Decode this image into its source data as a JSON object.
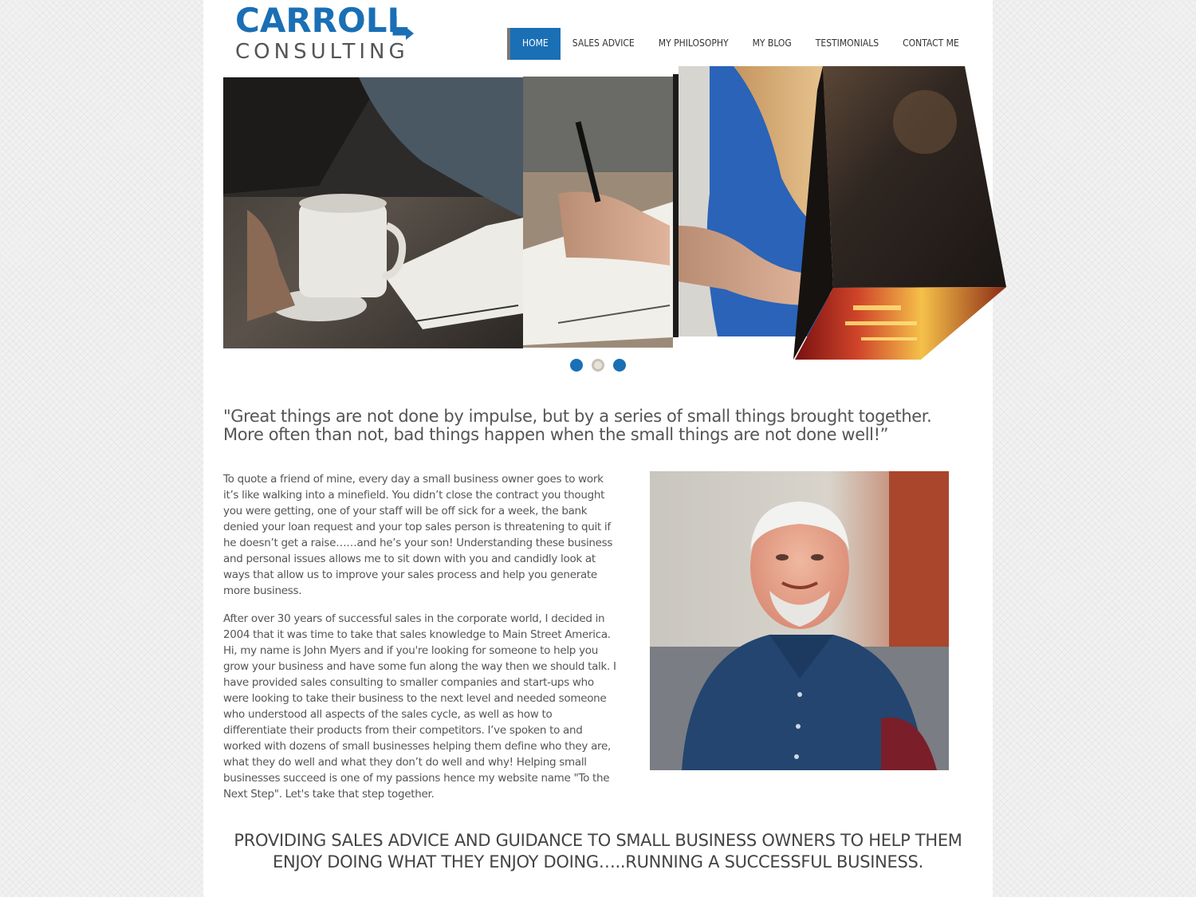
{
  "logo": {
    "line1": "CARROLL",
    "line2": "CONSULTING",
    "brand_color": "#1a6fb5"
  },
  "nav": {
    "items": [
      {
        "label": "HOME",
        "active": true
      },
      {
        "label": "SALES ADVICE"
      },
      {
        "label": "MY PHILOSOPHY"
      },
      {
        "label": "MY BLOG"
      },
      {
        "label": "TESTIMONIALS"
      },
      {
        "label": "CONTACT ME"
      }
    ]
  },
  "slider": {
    "slide_count": 3,
    "current_slide": 2
  },
  "quote": {
    "text": "\"Great things are not done by impulse, but by a series of small things brought together. More often than not, bad things happen when the small things are not done well!”"
  },
  "body": {
    "paragraph1": "To quote a friend of mine, every day a small business owner goes to work it’s like walking into a minefield. You didn’t close the contract you thought you were getting, one of your staff will be off sick for a week, the bank denied your loan request and your top sales person is threatening to quit if he doesn’t get a raise……and he’s your son! Understanding these business and personal issues allows me to sit down with you and candidly look at ways that allow us to improve your sales process and help you generate more business.",
    "paragraph2": "After over 30 years of successful sales in the corporate world, I decided in 2004 that it was time to take that sales knowledge to Main Street America. Hi, my name is John Myers and if you're looking for someone to help you grow your business and have some fun along the way then we should talk. I have provided sales consulting to smaller companies and start-ups who were looking to take their business to the next level and needed someone who understood all aspects of the sales cycle, as well as how to differentiate their products from their competitors. I’ve spoken to and worked with dozens of small businesses helping them define who they are, what they do well and what they don’t do well and why! Helping small businesses succeed is one of my passions hence my website name \"To the Next Step\". Let's take that step together."
  },
  "tagline": {
    "text": "PROVIDING SALES ADVICE AND GUIDANCE TO SMALL BUSINESS OWNERS TO HELP THEM ENJOY DOING WHAT THEY ENJOY DOING…..RUNNING A SUCCESSFUL BUSINESS."
  }
}
